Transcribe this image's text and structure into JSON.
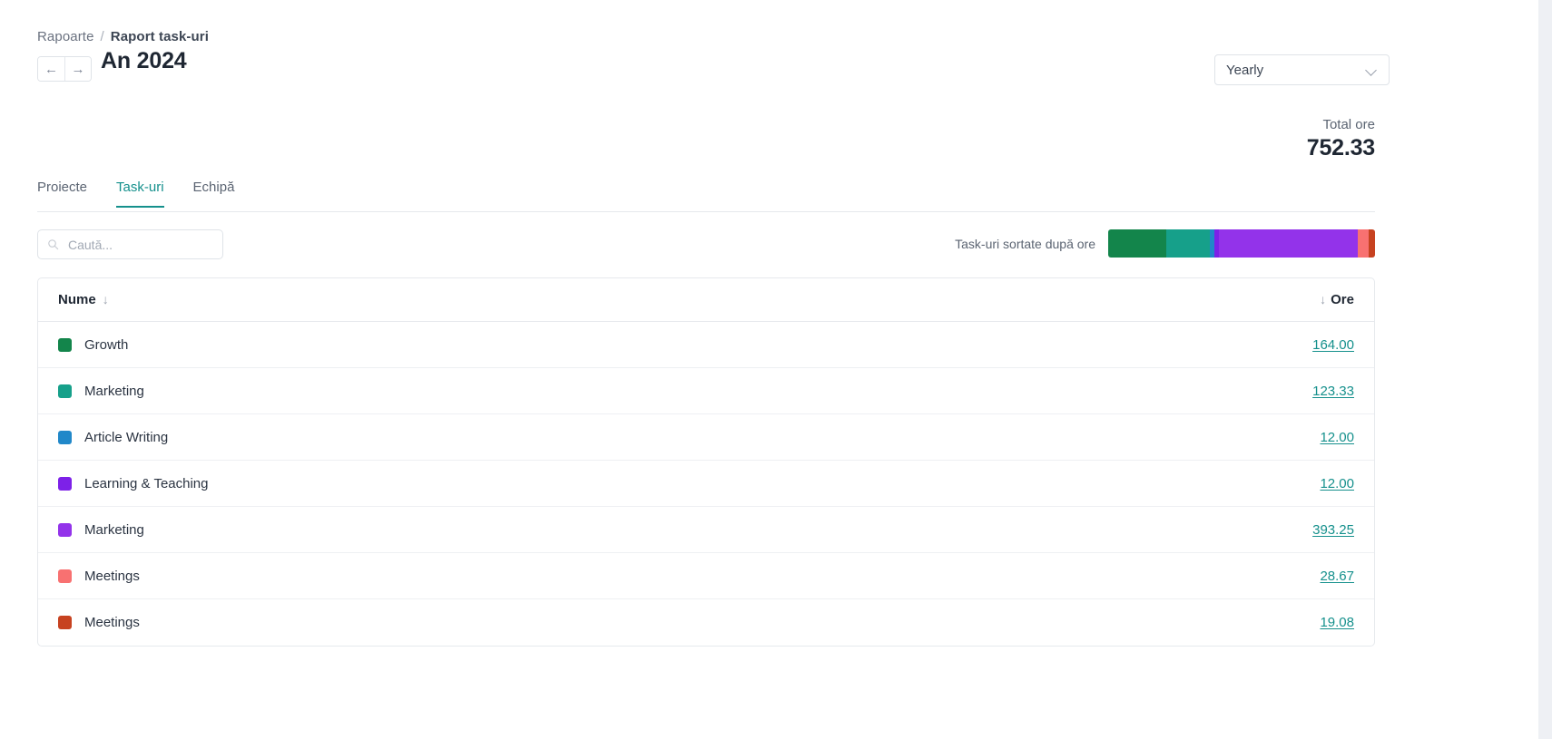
{
  "breadcrumb": {
    "parent": "Rapoarte",
    "separator": "/",
    "current": "Raport task-uri"
  },
  "header": {
    "prev_icon": "←",
    "next_icon": "→",
    "period_title": "An 2024",
    "range_select_value": "Yearly",
    "range_select_icon": "chevron-down-icon"
  },
  "summary": {
    "total_label": "Total ore",
    "total_value": "752.33"
  },
  "tabs": [
    {
      "label": "Proiecte",
      "active": false
    },
    {
      "label": "Task-uri",
      "active": true
    },
    {
      "label": "Echipă",
      "active": false
    }
  ],
  "filters": {
    "search_placeholder": "Caută...",
    "search_value": "",
    "search_icon": "search-icon"
  },
  "legend": {
    "label": "Task-uri sortate după ore"
  },
  "table": {
    "columns": {
      "name": "Nume",
      "hours": "Ore",
      "name_sort_icon": "↓",
      "hours_sort_icon": "↓"
    },
    "rows": [
      {
        "color": "#13854b",
        "name": "Growth",
        "hours": "164.00"
      },
      {
        "color": "#16a08a",
        "name": "Marketing",
        "hours": "123.33"
      },
      {
        "color": "#2188c9",
        "name": "Article Writing",
        "hours": "12.00"
      },
      {
        "color": "#7d21e8",
        "name": "Learning & Teaching",
        "hours": "12.00"
      },
      {
        "color": "#9333ea",
        "name": "Marketing",
        "hours": "393.25"
      },
      {
        "color": "#f87171",
        "name": "Meetings",
        "hours": "28.67"
      },
      {
        "color": "#c74220",
        "name": "Meetings",
        "hours": "19.08"
      }
    ]
  },
  "chart_data": {
    "type": "bar",
    "title": "Task-uri sortate după ore",
    "categories": [
      "Growth",
      "Marketing",
      "Article Writing",
      "Learning & Teaching",
      "Marketing",
      "Meetings",
      "Meetings"
    ],
    "values": [
      164.0,
      123.33,
      12.0,
      12.0,
      393.25,
      28.67,
      19.08
    ],
    "colors": [
      "#13854b",
      "#16a08a",
      "#2188c9",
      "#7d21e8",
      "#9333ea",
      "#f87171",
      "#c74220"
    ],
    "total": 752.33,
    "unit": "ore",
    "xlabel": "",
    "ylabel": "",
    "legend_position": "left",
    "grid": false,
    "stacked": true
  },
  "colors": {
    "accent": "#15908c",
    "text_primary": "#1f2733",
    "text_secondary": "#5b6472",
    "border": "#e6e9ed"
  }
}
